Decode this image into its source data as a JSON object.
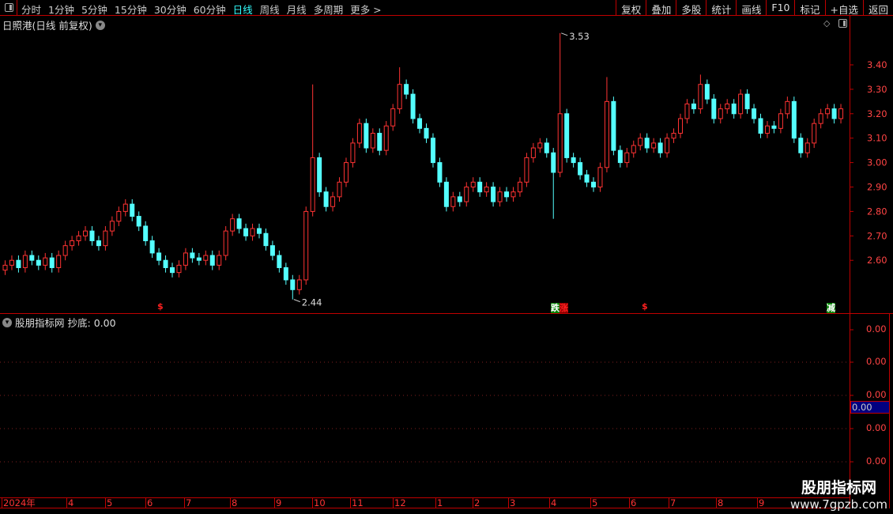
{
  "toolbar": {
    "periods": [
      "分时",
      "1分钟",
      "5分钟",
      "15分钟",
      "30分钟",
      "60分钟",
      "日线",
      "周线",
      "月线",
      "多周期",
      "更多 >"
    ],
    "active": "日线",
    "buttons": [
      "复权",
      "叠加",
      "多股",
      "统计",
      "画线",
      "F10",
      "标记",
      "+自选",
      "返回"
    ]
  },
  "chart": {
    "title": "日照港(日线 前复权)",
    "price_labels": [
      "3.40",
      "3.30",
      "3.20",
      "3.10",
      "3.00",
      "2.90",
      "2.80",
      "2.70",
      "2.60"
    ],
    "high_label": "3.53",
    "low_label": "2.44",
    "signals": [
      {
        "text": "$",
        "color": "#ff2020"
      },
      {
        "text": "涨",
        "color": "#ff2020",
        "bg": "#8b0000",
        "prefix": "跌"
      },
      {
        "text": "$",
        "color": "#ff2020"
      },
      {
        "text": "减",
        "color": "#fff",
        "bg": "#008000"
      }
    ],
    "up_color": "#ff3333",
    "down_color": "#54ffff"
  },
  "indicator": {
    "name": "股朋指标网",
    "label": "抄底: 0.00",
    "axis_labels": [
      "0.00",
      "0.00",
      "0.00",
      "0.00",
      "0.00"
    ],
    "current": "0.00"
  },
  "dates": [
    "2024年",
    "4",
    "5",
    "6",
    "7",
    "8",
    "9",
    "10",
    "11",
    "12",
    "1",
    "2",
    "3",
    "4",
    "5",
    "6",
    "7",
    "8",
    "9"
  ],
  "watermark": {
    "name": "股朋指标网",
    "url": "www.7gpzb.com"
  },
  "chart_data": {
    "type": "candlestick",
    "y_range": [
      2.4,
      3.56
    ],
    "closes": [
      2.58,
      2.6,
      2.57,
      2.62,
      2.6,
      2.58,
      2.61,
      2.57,
      2.62,
      2.66,
      2.68,
      2.7,
      2.72,
      2.68,
      2.66,
      2.72,
      2.76,
      2.8,
      2.83,
      2.78,
      2.74,
      2.68,
      2.63,
      2.6,
      2.57,
      2.55,
      2.58,
      2.63,
      2.61,
      2.6,
      2.62,
      2.58,
      2.62,
      2.72,
      2.77,
      2.73,
      2.7,
      2.73,
      2.71,
      2.66,
      2.62,
      2.57,
      2.52,
      2.48,
      2.52,
      2.8,
      3.02,
      2.88,
      2.82,
      2.86,
      2.92,
      3.0,
      3.08,
      3.16,
      3.06,
      3.12,
      3.05,
      3.15,
      3.22,
      3.32,
      3.28,
      3.18,
      3.14,
      3.1,
      3.0,
      2.92,
      2.82,
      2.86,
      2.84,
      2.9,
      2.92,
      2.88,
      2.9,
      2.84,
      2.88,
      2.86,
      2.88,
      2.92,
      3.02,
      3.06,
      3.08,
      3.04,
      2.96,
      3.2,
      3.02,
      3.0,
      2.95,
      2.92,
      2.9,
      2.98,
      3.25,
      3.05,
      3.0,
      3.04,
      3.07,
      3.1,
      3.06,
      3.08,
      3.04,
      3.1,
      3.12,
      3.18,
      3.24,
      3.22,
      3.32,
      3.26,
      3.18,
      3.22,
      3.24,
      3.2,
      3.28,
      3.22,
      3.18,
      3.12,
      3.15,
      3.14,
      3.2,
      3.25,
      3.1,
      3.04,
      3.08,
      3.16,
      3.2,
      3.22,
      3.18,
      3.22
    ],
    "extremes": [
      {
        "index": 43,
        "low": 2.44
      },
      {
        "index": 46,
        "high": 3.32
      },
      {
        "index": 59,
        "high": 3.39
      },
      {
        "index": 82,
        "low": 2.77
      },
      {
        "index": 83,
        "high": 3.53
      },
      {
        "index": 90,
        "high": 3.35
      },
      {
        "index": 104,
        "high": 3.36
      }
    ]
  }
}
